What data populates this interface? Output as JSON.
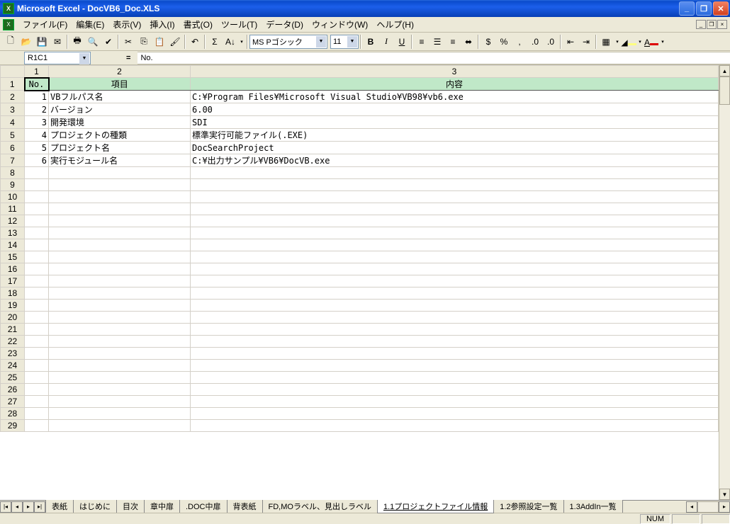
{
  "title": "Microsoft Excel - DocVB6_Doc.XLS",
  "menu": {
    "file": "ファイル(F)",
    "edit": "編集(E)",
    "view": "表示(V)",
    "insert": "挿入(I)",
    "format": "書式(O)",
    "tools": "ツール(T)",
    "data": "データ(D)",
    "window": "ウィンドウ(W)",
    "help": "ヘルプ(H)"
  },
  "toolbar": {
    "font_name": "MS Pゴシック",
    "font_size": "11"
  },
  "formula_bar": {
    "name_box": "R1C1",
    "eq": "=",
    "formula": "No."
  },
  "col_headers": {
    "c1": "1",
    "c2": "2",
    "c3": "3"
  },
  "headers": {
    "no": "No.",
    "item": "項目",
    "content": "内容"
  },
  "rows": [
    {
      "no": "1",
      "item": "VBフルパス名",
      "content": "C:¥Program Files¥Microsoft Visual Studio¥VB98¥vb6.exe"
    },
    {
      "no": "2",
      "item": "バージョン",
      "content": "6.00"
    },
    {
      "no": "3",
      "item": "開発環境",
      "content": "SDI"
    },
    {
      "no": "4",
      "item": "プロジェクトの種類",
      "content": "標準実行可能ファイル(.EXE)"
    },
    {
      "no": "5",
      "item": "プロジェクト名",
      "content": "DocSearchProject"
    },
    {
      "no": "6",
      "item": "実行モジュール名",
      "content": "C:¥出力サンプル¥VB6¥DocVB.exe"
    }
  ],
  "row_labels": [
    "1",
    "2",
    "3",
    "4",
    "5",
    "6",
    "7",
    "8",
    "9",
    "10",
    "11",
    "12",
    "13",
    "14",
    "15",
    "16",
    "17",
    "18",
    "19",
    "20",
    "21",
    "22",
    "23",
    "24",
    "25",
    "26",
    "27",
    "28",
    "29"
  ],
  "tabs": {
    "t0": "表紙",
    "t1": "はじめに",
    "t2": "目次",
    "t3": "章中扉",
    "t4": ".DOC中扉",
    "t5": "背表紙",
    "t6": "FD,MOラベル、見出しラベル",
    "t7": "1.1プロジェクトファイル情報",
    "t8": "1.2参照設定一覧",
    "t9": "1.3AddIn一覧"
  },
  "status": {
    "num": "NUM"
  }
}
